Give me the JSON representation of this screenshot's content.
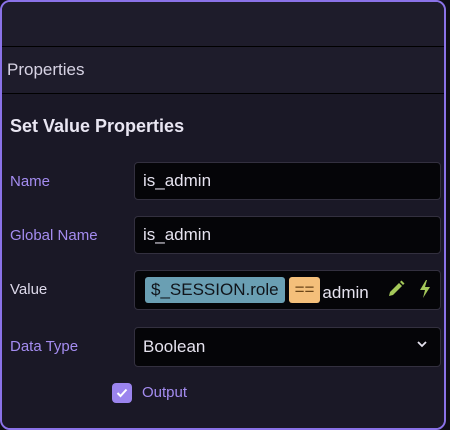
{
  "panel": {
    "section_title": "Properties",
    "heading": "Set Value Properties"
  },
  "fields": {
    "name": {
      "label": "Name",
      "value": "is_admin"
    },
    "global_name": {
      "label": "Global Name",
      "value": "is_admin"
    },
    "value": {
      "label": "Value",
      "variable": "$_SESSION.role",
      "operator": "==",
      "literal": "admin",
      "icons": [
        "pencil-icon",
        "lightning-icon"
      ]
    },
    "data_type": {
      "label": "Data Type",
      "selected": "Boolean"
    },
    "output": {
      "label": "Output",
      "checked": true
    }
  },
  "colors": {
    "accent": "#8a72e8",
    "label_purple": "#a48cf0",
    "variable_chip": "#6a9fb3",
    "operator_chip": "#f4bf7a",
    "icon_green": "#a5c95a"
  }
}
